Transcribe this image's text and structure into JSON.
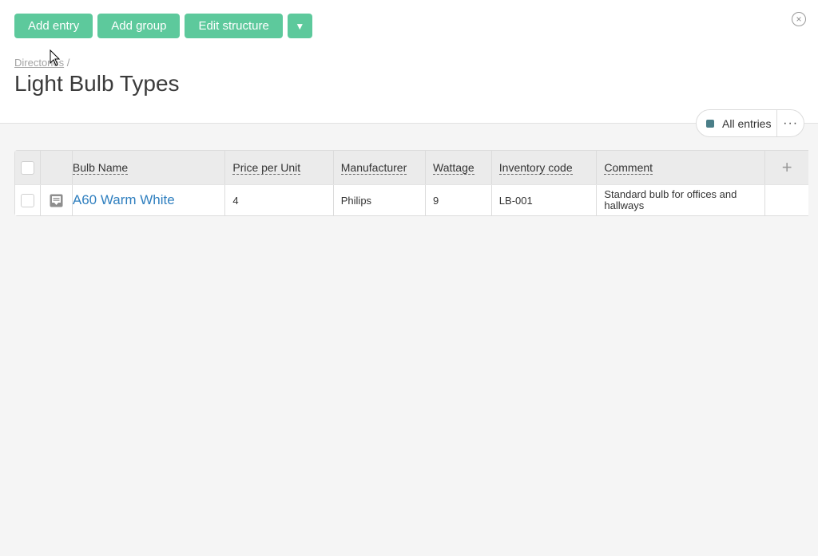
{
  "toolbar": {
    "add_entry": "Add entry",
    "add_group": "Add group",
    "edit_structure": "Edit structure",
    "more": "▼"
  },
  "header": {
    "close_icon": "×",
    "breadcrumb": {
      "parent": "Directories",
      "separator": " /"
    },
    "title": "Light Bulb Types"
  },
  "filter": {
    "label": "All entries",
    "swatch_color": "#4a7e88",
    "more_icon": "···"
  },
  "table": {
    "columns": [
      "Bulb Name",
      "Price per Unit",
      "Manufacturer",
      "Wattage",
      "Inventory code",
      "Comment"
    ],
    "add_column_icon": "+",
    "rows": [
      {
        "name": "A60 Warm White",
        "price": "4",
        "manufacturer": "Philips",
        "wattage": "9",
        "inventory_code": "LB-001",
        "comment": "Standard bulb for offices and hallways"
      }
    ]
  },
  "colors": {
    "accent": "#5dc99c",
    "link": "#2f7fbf"
  }
}
